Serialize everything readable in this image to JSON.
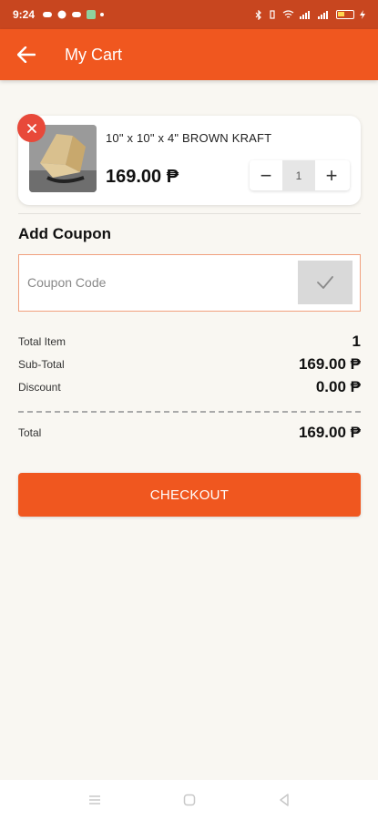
{
  "status_bar": {
    "time": "9:24",
    "battery_level": 0.4
  },
  "header": {
    "title": "My Cart"
  },
  "cart_item": {
    "name": "10\" x 10\" x 4\" BROWN KRAFT",
    "price": "169.00 ₱",
    "quantity": "1",
    "minus_label": "−",
    "plus_label": "+",
    "remove_label": "×"
  },
  "coupon": {
    "title": "Add Coupon",
    "placeholder": "Coupon Code",
    "value": ""
  },
  "summary": {
    "total_item_label": "Total Item",
    "total_item_value": "1",
    "subtotal_label": "Sub-Total",
    "subtotal_value": "169.00 ₱",
    "discount_label": "Discount",
    "discount_value": "0.00 ₱",
    "total_label": "Total",
    "total_value": "169.00 ₱"
  },
  "checkout": {
    "label": "CHECKOUT"
  },
  "colors": {
    "brand": "#f0571f",
    "status_bar": "#c8461f",
    "remove": "#e8493a",
    "background": "#f9f7f2"
  },
  "icons": {
    "back": "arrow-left-icon",
    "apply": "check-icon",
    "nav": [
      "menu-icon",
      "home-icon",
      "back-triangle-icon"
    ]
  }
}
